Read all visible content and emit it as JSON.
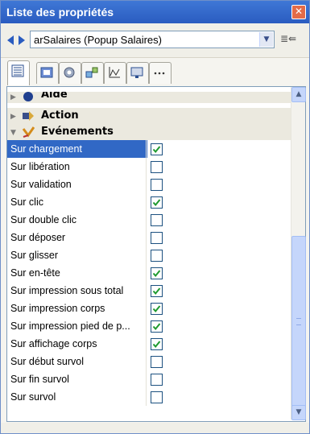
{
  "window": {
    "title": "Liste des propriétés"
  },
  "selector": {
    "value": "arSalaires (Popup Salaires)"
  },
  "tabs": [
    {
      "icon": "list-properties-icon",
      "active": true
    },
    {
      "icon": "form-icon"
    },
    {
      "icon": "gear-icon"
    },
    {
      "icon": "objects-icon"
    },
    {
      "icon": "chart-icon"
    },
    {
      "icon": "display-icon"
    },
    {
      "icon": "more-icon"
    }
  ],
  "categories": {
    "aide": "Aide",
    "action": "Action",
    "evenements": "Evénements"
  },
  "properties": [
    {
      "label": "Sur chargement",
      "checked": true,
      "selected": true
    },
    {
      "label": "Sur libération",
      "checked": false
    },
    {
      "label": "Sur validation",
      "checked": false
    },
    {
      "label": "Sur clic",
      "checked": true
    },
    {
      "label": "Sur double clic",
      "checked": false
    },
    {
      "label": "Sur déposer",
      "checked": false
    },
    {
      "label": "Sur glisser",
      "checked": false
    },
    {
      "label": "Sur en-tête",
      "checked": true
    },
    {
      "label": "Sur impression sous total",
      "checked": true
    },
    {
      "label": "Sur impression corps",
      "checked": true
    },
    {
      "label": "Sur impression pied de p...",
      "checked": true
    },
    {
      "label": "Sur affichage corps",
      "checked": true
    },
    {
      "label": "Sur début survol",
      "checked": false
    },
    {
      "label": "Sur fin survol",
      "checked": false
    },
    {
      "label": "Sur survol",
      "checked": false
    }
  ],
  "colors": {
    "titlebar": "#2f66cc",
    "selection": "#3168c5",
    "checkmark": "#1f9a2f"
  }
}
